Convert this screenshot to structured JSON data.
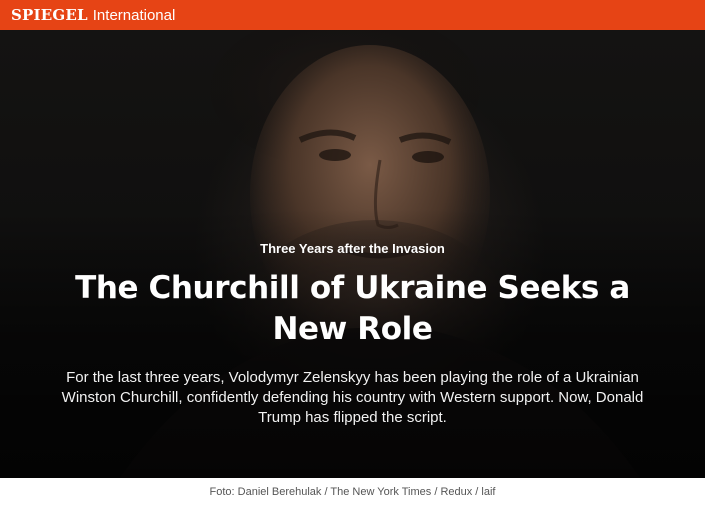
{
  "header": {
    "brand": "SPIEGEL",
    "section": "International",
    "accent_color": "#e64415"
  },
  "hero": {
    "kicker": "Three Years after the Invasion",
    "headline": "The Churchill of Ukraine Seeks a New Role",
    "teaser": "For the last three years, Volodymyr Zelenskyy has been playing the role of a Ukrainian Winston Churchill, confidently defending his country with Western support. Now, Donald Trump has flipped the script."
  },
  "photo": {
    "credit": "Foto: Daniel Berehulak / The New York Times / Redux / laif"
  }
}
